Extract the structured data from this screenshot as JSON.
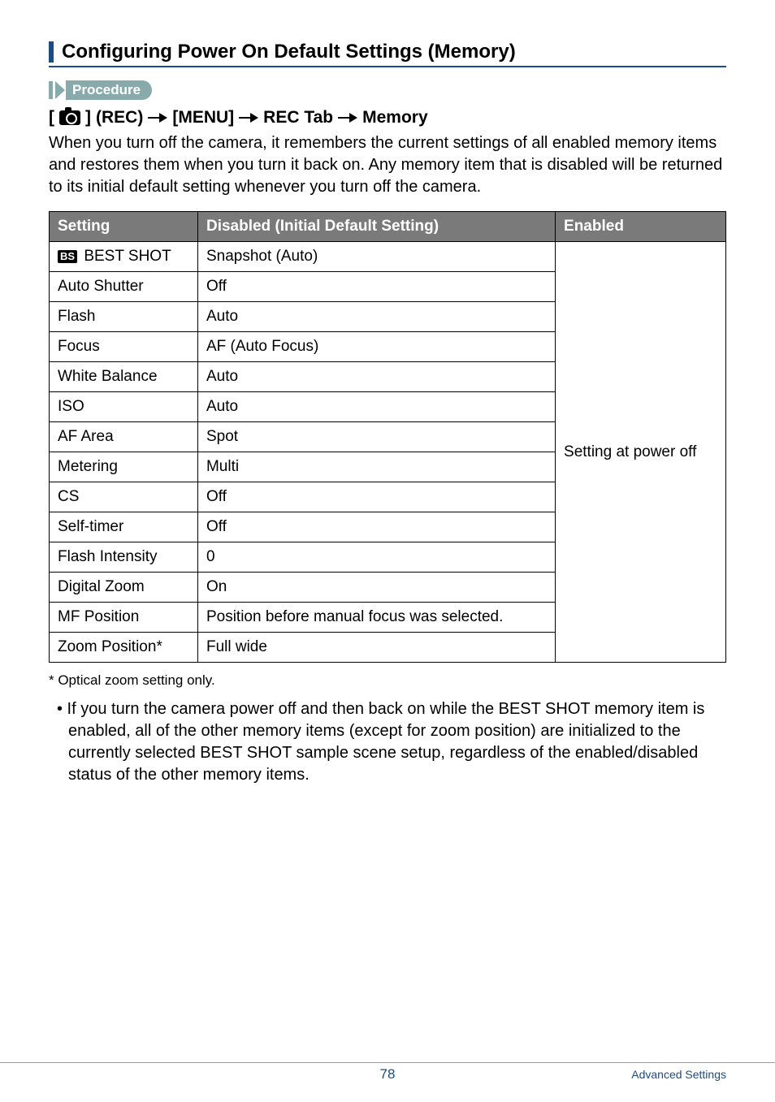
{
  "heading": "Configuring Power On Default Settings (Memory)",
  "procedure_label": "Procedure",
  "breadcrumb": {
    "rec": "(REC)",
    "menu": "[MENU]",
    "tab": "REC Tab",
    "memory": "Memory"
  },
  "intro": "When you turn off the camera, it remembers the current settings of all enabled memory items and restores them when you turn it back on. Any memory item that is disabled will be returned to its initial default setting whenever you turn off the camera.",
  "table": {
    "headers": {
      "setting": "Setting",
      "disabled": "Disabled (Initial Default Setting)",
      "enabled": "Enabled"
    },
    "enabled_text": "Setting at power off",
    "rows": [
      {
        "setting_prefix_icon": "BS",
        "setting": " BEST SHOT",
        "disabled": "Snapshot (Auto)"
      },
      {
        "setting": "Auto Shutter",
        "disabled": "Off"
      },
      {
        "setting": "Flash",
        "disabled": "Auto"
      },
      {
        "setting": "Focus",
        "disabled": "AF (Auto Focus)"
      },
      {
        "setting": "White Balance",
        "disabled": "Auto"
      },
      {
        "setting": "ISO",
        "disabled": "Auto"
      },
      {
        "setting": "AF Area",
        "disabled": "Spot"
      },
      {
        "setting": "Metering",
        "disabled": "Multi"
      },
      {
        "setting": "CS",
        "disabled": "Off"
      },
      {
        "setting": "Self-timer",
        "disabled": "Off"
      },
      {
        "setting": "Flash Intensity",
        "disabled": "0"
      },
      {
        "setting": "Digital Zoom",
        "disabled": "On"
      },
      {
        "setting": "MF Position",
        "disabled": "Position before manual focus was selected."
      },
      {
        "setting": "Zoom Position*",
        "disabled": "Full wide"
      }
    ]
  },
  "footnote": "* Optical zoom setting only.",
  "bullet": "• If you turn the camera power off and then back on while the BEST SHOT memory item is enabled, all of the other memory items (except for zoom position) are initialized to the currently selected BEST SHOT sample scene setup, regardless of the enabled/disabled status of the other memory items.",
  "footer": {
    "page": "78",
    "label": "Advanced Settings"
  }
}
